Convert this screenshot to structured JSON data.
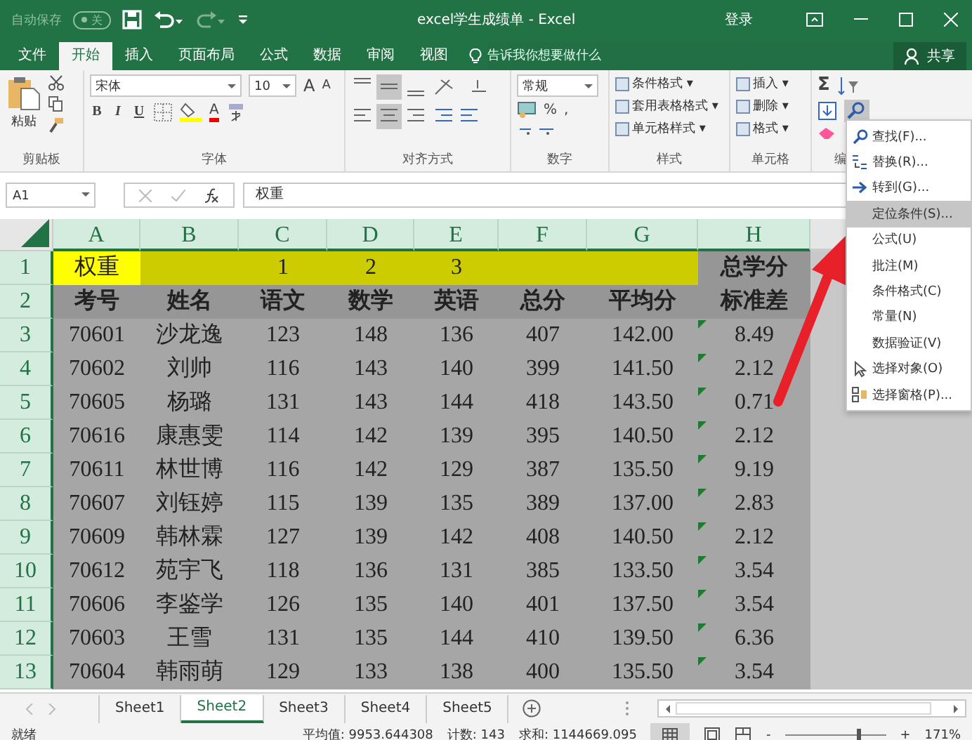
{
  "title_bar": {
    "autosave": "自动保存",
    "autosave_toggle": "关",
    "title": "excel学生成绩单 - Excel",
    "login": "登录"
  },
  "tabs": [
    {
      "label": "文件",
      "selected": false
    },
    {
      "label": "开始",
      "selected": true
    },
    {
      "label": "插入",
      "selected": false
    },
    {
      "label": "页面布局",
      "selected": false
    },
    {
      "label": "公式",
      "selected": false
    },
    {
      "label": "数据",
      "selected": false
    },
    {
      "label": "审阅",
      "selected": false
    },
    {
      "label": "视图",
      "selected": false
    }
  ],
  "tell_me": {
    "placeholder": "告诉我你想要做什么"
  },
  "share": "共享",
  "ribbon": {
    "clipboard": {
      "paste": "粘贴",
      "label": "剪贴板"
    },
    "font": {
      "name": "宋体",
      "size": "10",
      "grow": "A",
      "shrink": "A",
      "styles": [
        "B",
        "I",
        "U"
      ],
      "color_letter": "A",
      "label": "字体"
    },
    "alignment": {
      "label": "对齐方式"
    },
    "number": {
      "format": "常规",
      "percent": "%",
      "comma": ",",
      "label": "数字"
    },
    "styles": {
      "items": [
        "条件格式 ▾",
        "套用表格格式 ▾",
        "单元格样式 ▾"
      ],
      "label": "样式"
    },
    "cells": {
      "items": [
        "插入 ▾",
        "删除 ▾",
        "格式 ▾"
      ],
      "label": "单元格"
    },
    "editing": {
      "sum": "Σ",
      "label": "编"
    }
  },
  "formula_bar": {
    "name_box": "A1",
    "formula": "权重"
  },
  "columns": [
    "A",
    "B",
    "C",
    "D",
    "E",
    "F",
    "G",
    "H"
  ],
  "rows": [
    {
      "number": "1",
      "kind": "weights",
      "flagged": false,
      "cells": [
        {
          "text": "权重",
          "color": "#ffff00",
          "bold": false
        },
        {
          "text": "",
          "color": "#cccc00"
        },
        {
          "text": "1",
          "color": "#cccc00",
          "bold": false
        },
        {
          "text": "2",
          "color": "#cccc00",
          "bold": false
        },
        {
          "text": "3",
          "color": "#cccc00",
          "bold": false
        },
        {
          "text": "",
          "color": "#cccc00"
        },
        {
          "text": "",
          "color": "#cccc00"
        },
        {
          "text": "总学分",
          "color": "#969696",
          "bold": true
        }
      ]
    },
    {
      "number": "2",
      "kind": "header",
      "flagged": false,
      "cells": [
        "考号",
        "姓名",
        "语文",
        "数学",
        "英语",
        "总分",
        "平均分",
        "标准差"
      ]
    },
    {
      "number": "3",
      "kind": "data",
      "flagged": true,
      "cells": [
        "70601",
        "沙龙逸",
        "123",
        "148",
        "136",
        "407",
        "142.00",
        "8.49"
      ]
    },
    {
      "number": "4",
      "kind": "data",
      "flagged": true,
      "cells": [
        "70602",
        "刘帅",
        "116",
        "143",
        "140",
        "399",
        "141.50",
        "2.12"
      ]
    },
    {
      "number": "5",
      "kind": "data",
      "flagged": true,
      "cells": [
        "70605",
        "杨璐",
        "131",
        "143",
        "144",
        "418",
        "143.50",
        "0.71"
      ]
    },
    {
      "number": "6",
      "kind": "data",
      "flagged": true,
      "cells": [
        "70616",
        "康惠雯",
        "114",
        "142",
        "139",
        "395",
        "140.50",
        "2.12"
      ]
    },
    {
      "number": "7",
      "kind": "data",
      "flagged": true,
      "cells": [
        "70611",
        "林世博",
        "116",
        "142",
        "129",
        "387",
        "135.50",
        "9.19"
      ]
    },
    {
      "number": "8",
      "kind": "data",
      "flagged": true,
      "cells": [
        "70607",
        "刘钰婷",
        "115",
        "139",
        "135",
        "389",
        "137.00",
        "2.83"
      ]
    },
    {
      "number": "9",
      "kind": "data",
      "flagged": true,
      "cells": [
        "70609",
        "韩林霖",
        "127",
        "139",
        "142",
        "408",
        "140.50",
        "2.12"
      ]
    },
    {
      "number": "10",
      "kind": "data",
      "flagged": true,
      "cells": [
        "70612",
        "苑宇飞",
        "118",
        "136",
        "131",
        "385",
        "133.50",
        "3.54"
      ]
    },
    {
      "number": "11",
      "kind": "data",
      "flagged": true,
      "cells": [
        "70606",
        "李鉴学",
        "126",
        "135",
        "140",
        "401",
        "137.50",
        "3.54"
      ]
    },
    {
      "number": "12",
      "kind": "data",
      "flagged": true,
      "cells": [
        "70603",
        "王雪",
        "131",
        "135",
        "144",
        "410",
        "139.50",
        "6.36"
      ]
    },
    {
      "number": "13",
      "kind": "data",
      "flagged": true,
      "cells": [
        "70604",
        "韩雨萌",
        "129",
        "133",
        "138",
        "400",
        "135.50",
        "3.54"
      ]
    }
  ],
  "find_menu": [
    {
      "label": "查找(F)...",
      "kind": "search",
      "selected": false
    },
    {
      "label": "替换(R)...",
      "kind": "replace",
      "selected": false
    },
    {
      "label": "转到(G)...",
      "kind": "goto",
      "selected": false
    },
    {
      "label": "定位条件(S)...",
      "kind": "plain",
      "selected": true
    },
    {
      "label": "公式(U)",
      "kind": "plain",
      "selected": false
    },
    {
      "label": "批注(M)",
      "kind": "plain",
      "selected": false
    },
    {
      "label": "条件格式(C)",
      "kind": "plain",
      "selected": false
    },
    {
      "label": "常量(N)",
      "kind": "plain",
      "selected": false
    },
    {
      "label": "数据验证(V)",
      "kind": "plain",
      "selected": false
    },
    {
      "label": "选择对象(O)",
      "kind": "pointer",
      "selected": false
    },
    {
      "label": "选择窗格(P)...",
      "kind": "pane",
      "selected": false
    }
  ],
  "sheet_tabs": [
    {
      "label": "Sheet1",
      "selected": false
    },
    {
      "label": "Sheet2",
      "selected": true
    },
    {
      "label": "Sheet3",
      "selected": false
    },
    {
      "label": "Sheet4",
      "selected": false
    },
    {
      "label": "Sheet5",
      "selected": false
    }
  ],
  "status_bar": {
    "state": "就绪",
    "average": "平均值: 9953.644308",
    "count": "计数: 143",
    "sum": "求和: 1144669.095",
    "zoom_out": "-",
    "zoom_in": "+",
    "zoom": {
      "level": 0.72
    },
    "zoom_text": "171%"
  }
}
